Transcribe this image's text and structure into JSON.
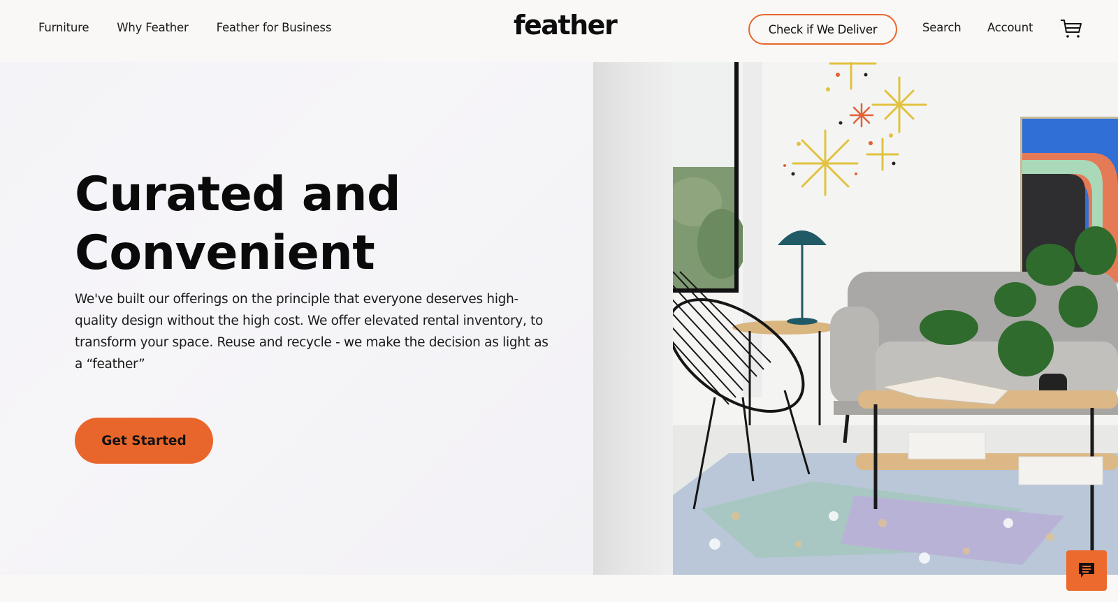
{
  "header": {
    "nav_left": [
      {
        "label": "Furniture"
      },
      {
        "label": "Why Feather"
      },
      {
        "label": "Feather for Business"
      }
    ],
    "logo": "feather",
    "deliver_button": "Check if We Deliver",
    "search": "Search",
    "account": "Account",
    "cart_icon": "cart-icon"
  },
  "hero": {
    "headline_line1": "Curated and",
    "headline_line2": "Convenient",
    "description": "We've built our offerings on the principle that everyone deserves high-quality design without the high cost. We offer elevated rental inventory, to transform your space. Reuse and recycle - we make the decision as light as a “feather”",
    "cta_button": "Get Started",
    "image_alt": "Living room with gray sofa, black acapulco chair, wooden coffee table, monstera plant, teal lamp, and patterned rug"
  },
  "chat": {
    "icon": "chat-icon"
  },
  "colors": {
    "accent": "#e8662b",
    "background": "#f9f8f6",
    "text": "#111111"
  }
}
